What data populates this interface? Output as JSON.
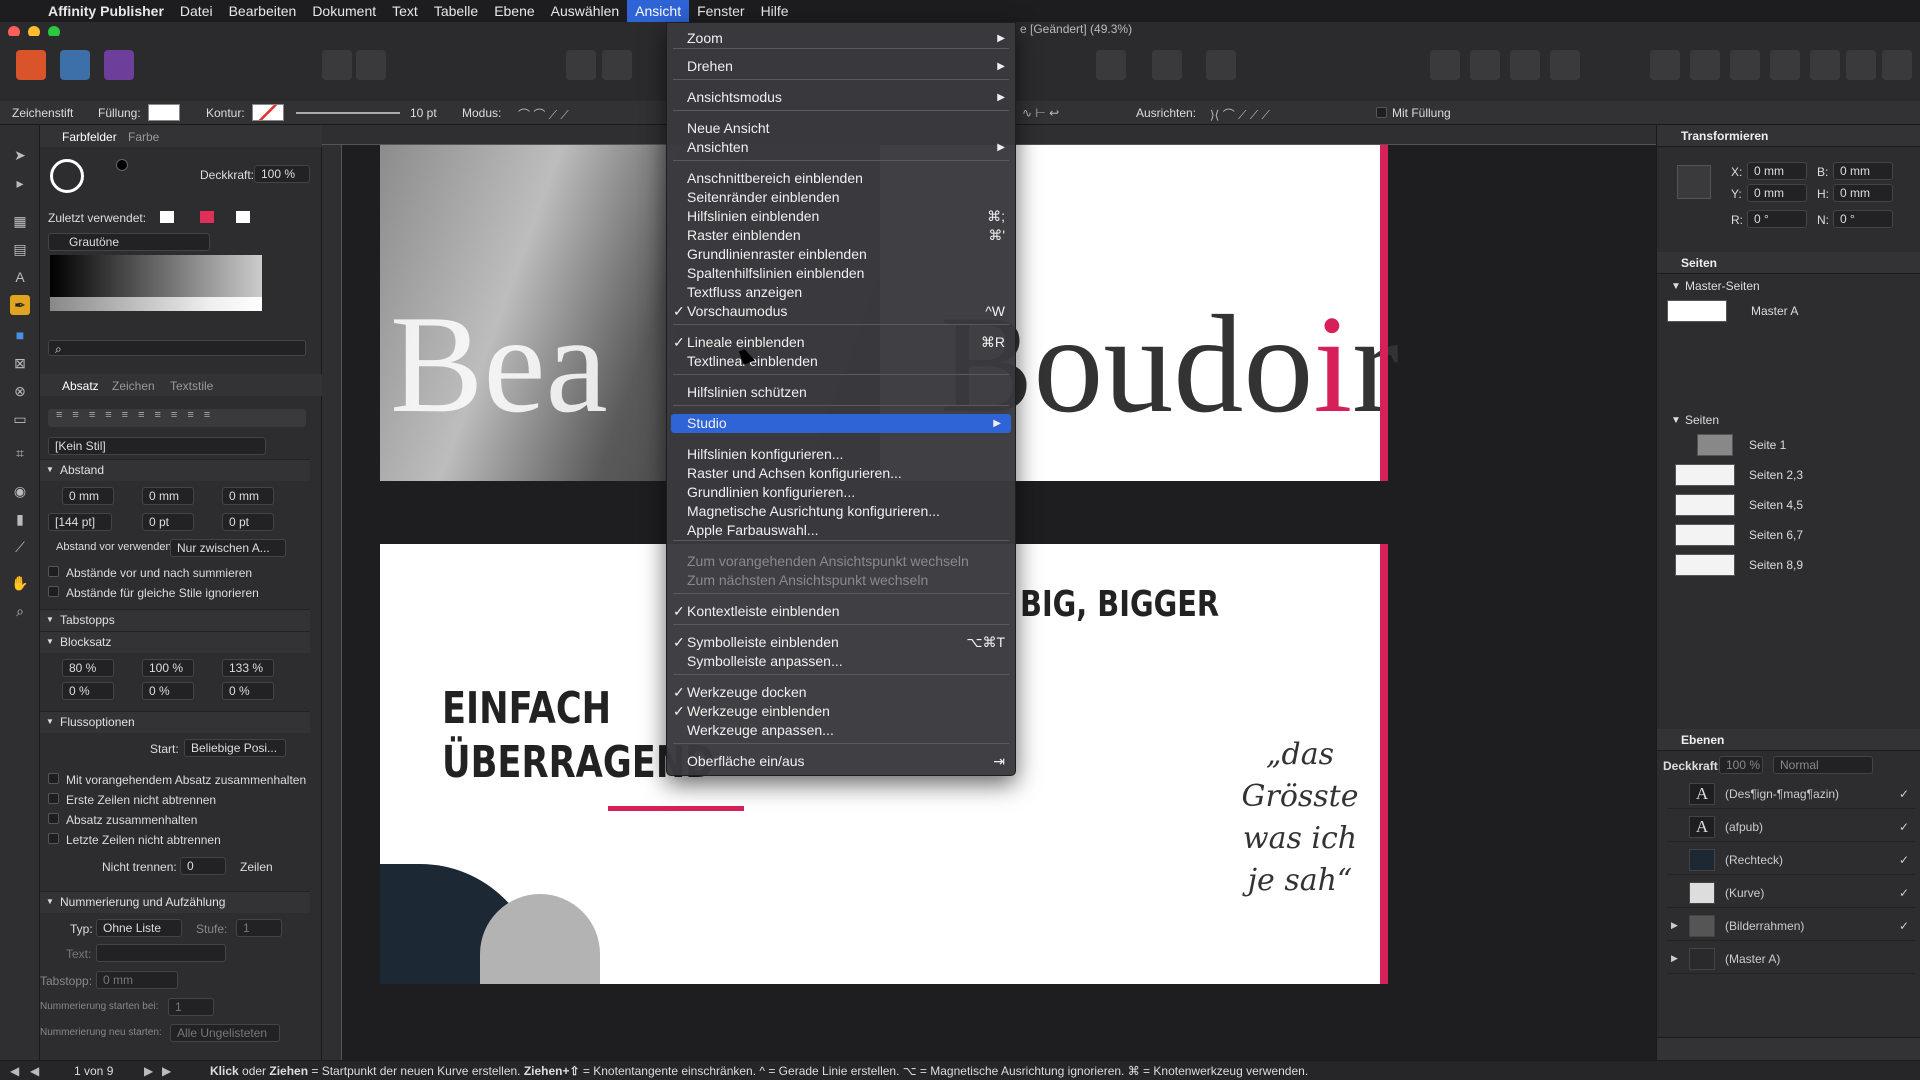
{
  "menubar": {
    "apple": "",
    "app": "Affinity Publisher",
    "items": [
      "Datei",
      "Bearbeiten",
      "Dokument",
      "Text",
      "Tabelle",
      "Ebene",
      "Auswählen",
      "Ansicht",
      "Fenster",
      "Hilfe"
    ]
  },
  "window_title": "e [Geändert] (49.3%)",
  "ctx": {
    "tool": "Zeichenstift",
    "fill": "Füllung:",
    "stroke": "Kontur:",
    "width": "10 pt",
    "mode": "Modus:",
    "align": "Ausrichten:",
    "withfill": "Mit Füllung"
  },
  "left": {
    "tabs": [
      "Farbfelder",
      "Farbe"
    ],
    "opacity_label": "Deckkraft:",
    "opacity": "100 %",
    "recent": "Zuletzt verwendet:",
    "palette": "Grautöne",
    "para_tabs": [
      "Absatz",
      "Zeichen",
      "Textstile"
    ],
    "style": "[Kein Stil]",
    "abstand": "Abstand",
    "sp": [
      "0 mm",
      "0 mm",
      "0 mm"
    ],
    "lead": "[144 pt]",
    "sp2": [
      "0 pt",
      "0 pt"
    ],
    "abstand_vor": "Abstand vor verwenden:",
    "nur": "Nur zwischen A...",
    "chk1": "Abstände vor und nach summieren",
    "chk2": "Abstände für gleiche Stile ignorieren",
    "tabstopps": "Tabstopps",
    "blocksatz": "Blocksatz",
    "bs1": [
      "80 %",
      "100 %",
      "133 %"
    ],
    "bs2": [
      "0 %",
      "0 %",
      "0 %"
    ],
    "fluss": "Flussoptionen",
    "start": "Start:",
    "start_val": "Beliebige Posi...",
    "f1": "Mit vorangehendem Absatz zusammenhalten",
    "f2": "Erste Zeilen nicht abtrennen",
    "f3": "Absatz zusammenhalten",
    "f4": "Letzte Zeilen nicht abtrennen",
    "nicht": "Nicht trennen:",
    "nicht_val": "0",
    "zeilen": "Zeilen",
    "numm": "Nummerierung und Aufzählung",
    "typ": "Typ:",
    "typ_val": "Ohne Liste",
    "stufe": "Stufe:",
    "stufe_val": "1",
    "text": "Text:",
    "tabstopp": "Tabstopp:",
    "tabstopp_val": "0 mm",
    "start_bei": "Nummerierung starten bei:",
    "start_bei_val": "1",
    "neu": "Nummerierung neu starten:",
    "neu_val": "Alle Ungelisteten"
  },
  "menu": [
    {
      "label": "Zoom",
      "sub": true
    },
    {
      "label": "Drehen",
      "sub": true
    },
    {
      "label": "Ansichtsmodus",
      "sub": true
    },
    {
      "label": "Neue Ansicht"
    },
    {
      "label": "Ansichten",
      "sub": true
    },
    {
      "label": "Anschnittbereich einblenden"
    },
    {
      "label": "Seitenränder einblenden"
    },
    {
      "label": "Hilfslinien einblenden",
      "sc": "⌘;"
    },
    {
      "label": "Raster einblenden",
      "sc": "⌘'"
    },
    {
      "label": "Grundlinienraster einblenden"
    },
    {
      "label": "Spaltenhilfslinien einblenden"
    },
    {
      "label": "Textfluss anzeigen"
    },
    {
      "label": "Vorschaumodus",
      "check": true,
      "sc": "^W"
    },
    {
      "label": "Lineale einblenden",
      "check": true,
      "sc": "⌘R"
    },
    {
      "label": "Textlineal einblenden"
    },
    {
      "label": "Hilfslinien schützen"
    },
    {
      "label": "Studio",
      "sub": true,
      "hl": true
    },
    {
      "label": "Hilfslinien konfigurieren..."
    },
    {
      "label": "Raster und Achsen konfigurieren..."
    },
    {
      "label": "Grundlinien konfigurieren..."
    },
    {
      "label": "Magnetische Ausrichtung konfigurieren..."
    },
    {
      "label": "Apple Farbauswahl..."
    },
    {
      "label": "Zum vorangehenden Ansichtspunkt wechseln",
      "dis": true
    },
    {
      "label": "Zum nächsten Ansichtspunkt wechseln",
      "dis": true
    },
    {
      "label": "Kontextleiste einblenden",
      "check": true
    },
    {
      "label": "Symbolleiste einblenden",
      "check": true,
      "sc": "⌥⌘T"
    },
    {
      "label": "Symbolleiste anpassen..."
    },
    {
      "label": "Werkzeuge docken",
      "check": true
    },
    {
      "label": "Werkzeuge einblenden",
      "check": true
    },
    {
      "label": "Werkzeuge anpassen..."
    },
    {
      "label": "Oberfläche ein/aus",
      "sc": "⇥"
    }
  ],
  "canvas": {
    "beauty": "Bea",
    "boudoir_a": "Boudo",
    "boudoir_i": "i",
    "boudoir_r": "r",
    "big": "BIG, BIGGER",
    "einfach": "EINFACH",
    "ueberragend": "ÜBERRAGEND",
    "quote": "„das Grösste was ich je sah“"
  },
  "right": {
    "transform": "Transformieren",
    "x": "X:",
    "xv": "0 mm",
    "y": "Y:",
    "yv": "0 mm",
    "b": "B:",
    "bv": "0 mm",
    "h": "H:",
    "hv": "0 mm",
    "r": "R:",
    "rv": "0 °",
    "n": "N:",
    "nv": "0 °",
    "seiten": "Seiten",
    "master": "Master-Seiten",
    "masterA": "Master A",
    "seiten_sub": "Seiten",
    "pages": [
      "Seite 1",
      "Seiten 2,3",
      "Seiten 4,5",
      "Seiten 6,7",
      "Seiten 8,9"
    ],
    "ebenen": "Ebenen",
    "deck": "Deckkraft:",
    "deck_val": "100 %",
    "blend": "Normal",
    "layers": [
      {
        "icon": "A",
        "name": "(Des¶ign-¶mag¶azin)"
      },
      {
        "icon": "A",
        "name": "(afpub)"
      },
      {
        "icon": "",
        "name": "(Rechteck)"
      },
      {
        "icon": "",
        "name": "(Kurve)"
      },
      {
        "icon": "",
        "name": "(Bilderrahmen)"
      },
      {
        "icon": "",
        "name": "(Master A)"
      }
    ]
  },
  "status": {
    "page": "1 von 9",
    "hint_b1": "Klick",
    "hint_t1": " oder ",
    "hint_b2": "Ziehen",
    "hint_t2": " = Startpunkt der neuen Kurve erstellen. ",
    "hint_b3": "Ziehen+⇧",
    "hint_t3": " = Knotentangente einschränken. ^ = Gerade Linie erstellen. ⌥ = Magnetische Ausrichtung ignorieren. ⌘ = Knotenwerkzeug verwenden."
  }
}
